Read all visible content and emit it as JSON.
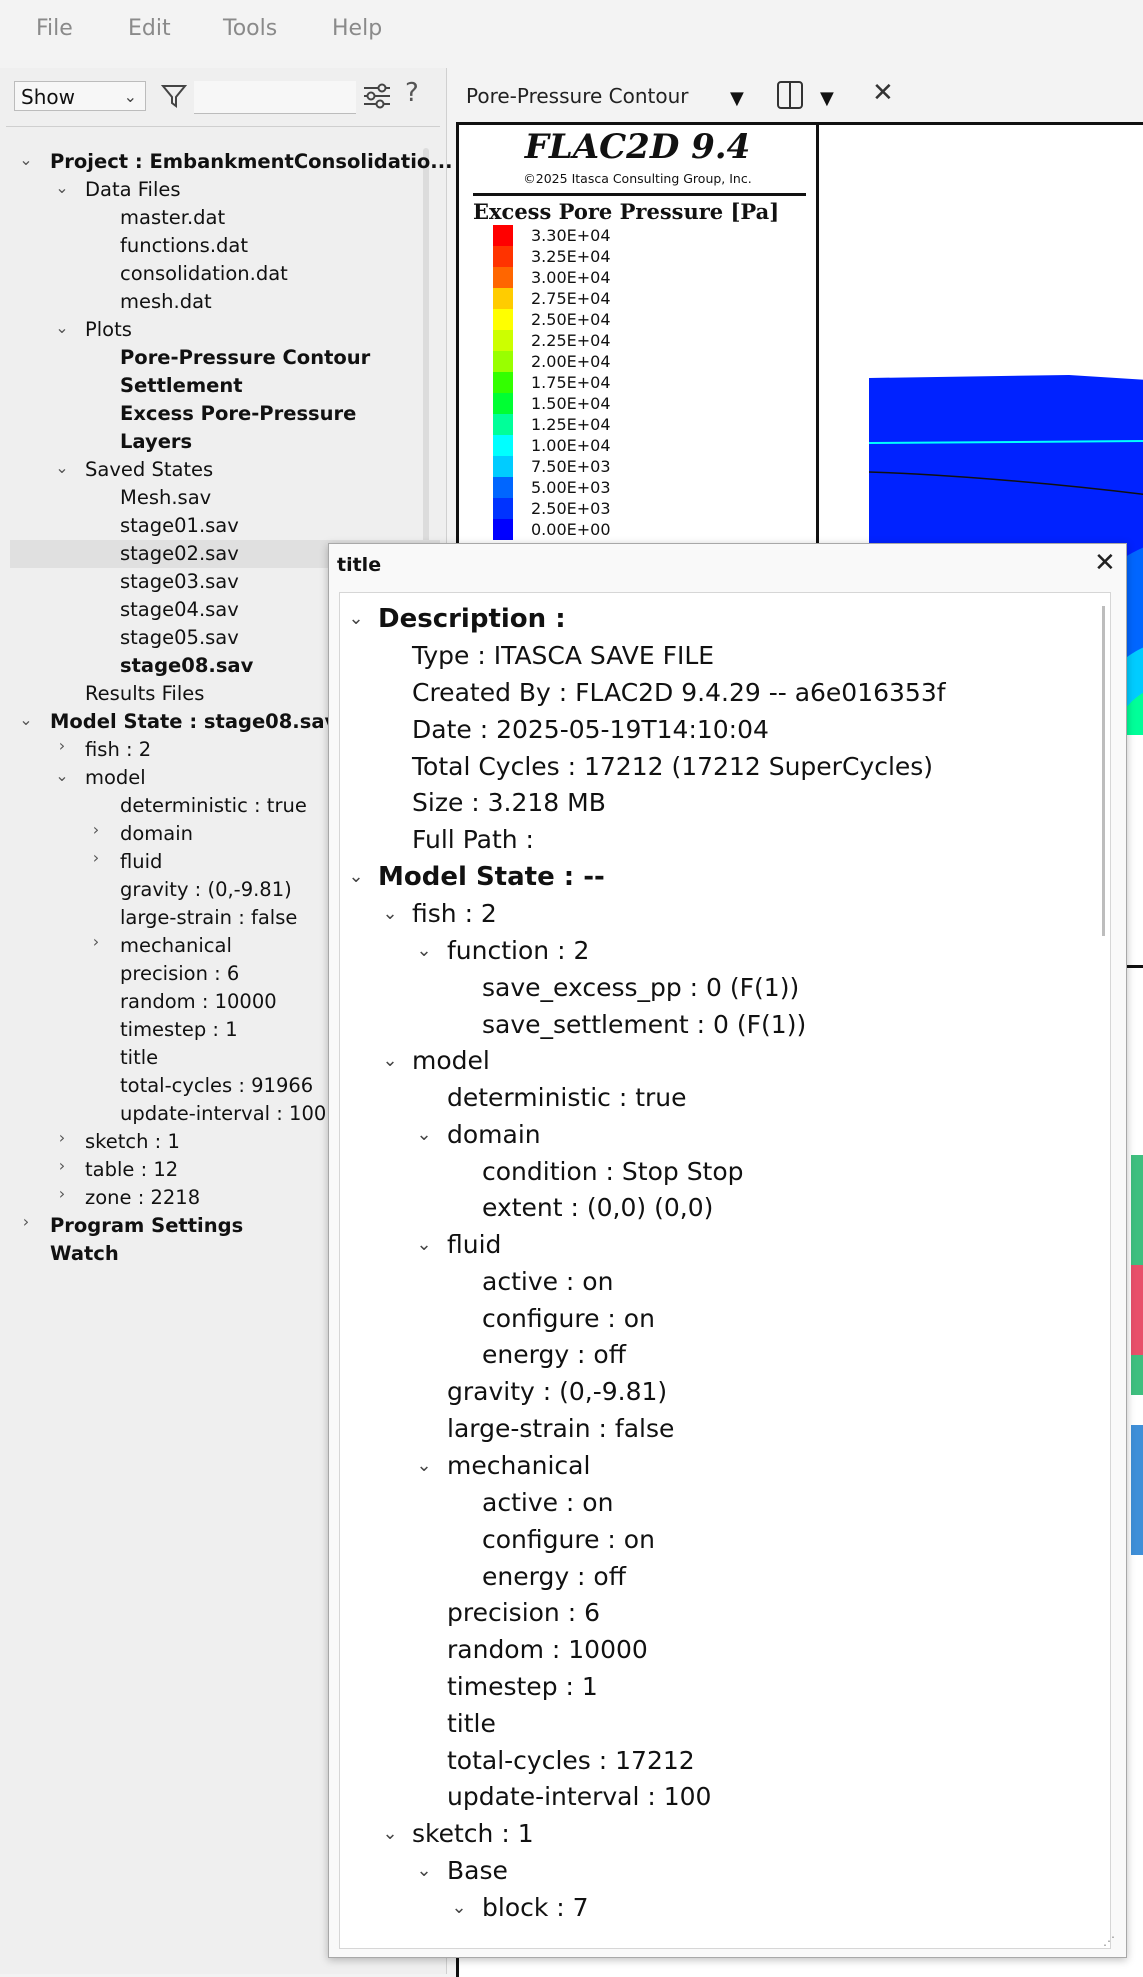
{
  "menu": {
    "file": "File",
    "edit": "Edit",
    "tools": "Tools",
    "help": "Help"
  },
  "toolbar": {
    "show_value": "Show",
    "filter_placeholder": "",
    "help_label": "?"
  },
  "tree": {
    "project": "Project :  EmbankmentConsolidatio...",
    "data_files": "Data Files",
    "master": "master.dat",
    "functions": "functions.dat",
    "consolidation": "consolidation.dat",
    "mesh": "mesh.dat",
    "plots": "Plots",
    "plot_pp": "Pore-Pressure Contour",
    "plot_settlement": "Settlement",
    "plot_excess": "Excess Pore-Pressure",
    "plot_layers": "Layers",
    "saved_states": "Saved States",
    "mesh_sav": "Mesh.sav",
    "stage01": "stage01.sav",
    "stage02": "stage02.sav",
    "stage03": "stage03.sav",
    "stage04": "stage04.sav",
    "stage05": "stage05.sav",
    "stage08": "stage08.sav",
    "results_files": "Results Files",
    "model_state": "Model State :  stage08.sav",
    "fish": "fish :  2",
    "model": "model",
    "deterministic": "deterministic :  true",
    "domain": "domain",
    "fluid": "fluid",
    "gravity": "gravity :  (0,-9.81)",
    "large_strain": "large-strain :  false",
    "mechanical": "mechanical",
    "precision": "precision :  6",
    "random": "random :  10000",
    "timestep": "timestep :  1",
    "title": "title",
    "total_cycles": "total-cycles :  91966",
    "update_interval": "update-interval :  100",
    "sketch": "sketch :  1",
    "table": "table :  12",
    "zone": "zone :  2218",
    "program_settings": "Program Settings",
    "watch": "Watch"
  },
  "plot": {
    "tab_title": "Pore-Pressure Contour",
    "close_label": "✕",
    "flac_title": "FLAC2D 9.4",
    "copyright": "©2025 Itasca Consulting Group, Inc.",
    "legend_title": "Excess Pore Pressure [Pa]",
    "legend": [
      {
        "label": "3.30E+04",
        "color": "#ff0000"
      },
      {
        "label": "3.25E+04",
        "color": "#ff3300"
      },
      {
        "label": "3.00E+04",
        "color": "#ff6600"
      },
      {
        "label": "2.75E+04",
        "color": "#ffcc00"
      },
      {
        "label": "2.50E+04",
        "color": "#ffff00"
      },
      {
        "label": "2.25E+04",
        "color": "#ccff00"
      },
      {
        "label": "2.00E+04",
        "color": "#99ff00"
      },
      {
        "label": "1.75E+04",
        "color": "#33ff00"
      },
      {
        "label": "1.50E+04",
        "color": "#00ff33"
      },
      {
        "label": "1.25E+04",
        "color": "#00ff99"
      },
      {
        "label": "1.00E+04",
        "color": "#00ffff"
      },
      {
        "label": "7.50E+03",
        "color": "#00ccff"
      },
      {
        "label": "5.00E+03",
        "color": "#0066ff"
      },
      {
        "label": "2.50E+03",
        "color": "#0033ff"
      },
      {
        "label": "0.00E+00",
        "color": "#0000ff"
      }
    ]
  },
  "dialog": {
    "title": "title",
    "close_label": "✕",
    "description": "Description :",
    "type": "Type :   ITASCA SAVE FILE",
    "created_by": "Created By :   FLAC2D 9.4.29 -- a6e016353f",
    "date": "Date :   2025-05-19T14:10:04",
    "total_cycles": "Total Cycles :  17212  (17212 SuperCycles)",
    "size": "Size :  3.218 MB",
    "full_path": "Full Path :",
    "model_state": "Model State :  --",
    "fish": "fish :  2",
    "function": "function :  2",
    "save_excess_pp": "save_excess_pp :  0 (F(1))",
    "save_settlement": "save_settlement :  0 (F(1))",
    "model": "model",
    "deterministic": "deterministic :  true",
    "domain": "domain",
    "condition": "condition :  Stop Stop",
    "extent": "extent :  (0,0) (0,0)",
    "fluid": "fluid",
    "fluid_active": "active :  on",
    "fluid_configure": "configure :  on",
    "fluid_energy": "energy :  off",
    "gravity": "gravity :  (0,-9.81)",
    "large_strain": "large-strain :  false",
    "mechanical": "mechanical",
    "mech_active": "active :  on",
    "mech_configure": "configure :  on",
    "mech_energy": "energy :  off",
    "precision": "precision :  6",
    "random": "random :  10000",
    "timestep": "timestep :  1",
    "total_cycles_model": "total-cycles :  17212",
    "update_interval": "update-interval :  100",
    "sketch": "sketch :  1",
    "base": "Base",
    "block": "block :  7"
  }
}
